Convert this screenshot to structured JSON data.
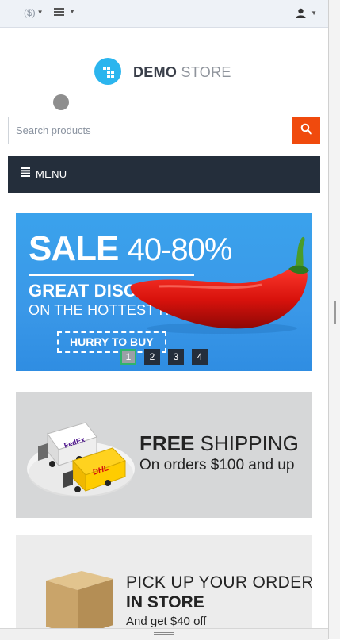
{
  "topbar": {
    "currency_label": "($)",
    "list_toggle_icon": "list-icon",
    "user_icon": "user-icon"
  },
  "logo": {
    "brand_bold": "DEMO",
    "brand_light": "STORE",
    "accent": "#2bb5ee"
  },
  "search": {
    "placeholder": "Search products",
    "value": "",
    "button_icon": "search-icon",
    "button_color": "#f04a0d"
  },
  "menu": {
    "label": "MENU",
    "icon": "menu-icon",
    "background": "#242e3b"
  },
  "hero": {
    "sale_word": "SALE",
    "sale_range": "40-80%",
    "line1": "GREAT DISCOUNTS",
    "line2": "ON THE HOTTEST ITEMS",
    "cta": "HURRY TO BUY",
    "pager": [
      "1",
      "2",
      "3",
      "4"
    ],
    "active_page": "1"
  },
  "shipping_banner": {
    "title_bold": "FREE",
    "title_rest": "SHIPPING",
    "subtitle": "On orders $100 and up",
    "truck_brands": [
      "FedEx",
      "DHL"
    ]
  },
  "pickup_banner": {
    "line1": "PICK UP YOUR ORDER",
    "line2": "IN STORE",
    "line3": "And get $40 off"
  }
}
